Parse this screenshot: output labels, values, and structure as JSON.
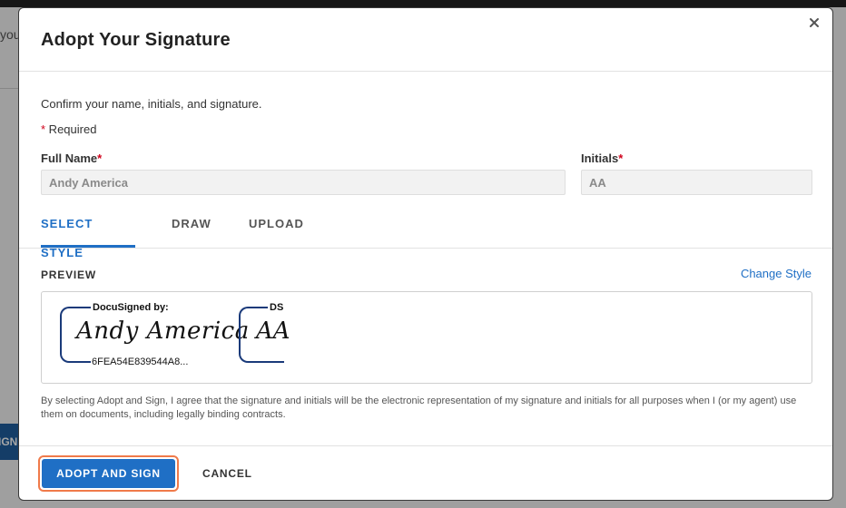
{
  "background": {
    "partial_text": "you",
    "sign_button_fragment": "IGN"
  },
  "modal": {
    "title": "Adopt Your Signature",
    "close_label": "×",
    "intro": "Confirm your name, initials, and signature.",
    "required_star": "*",
    "required_text": " Required",
    "full_name_label": "Full Name",
    "full_name_value": "Andy America",
    "initials_label": "Initials",
    "initials_value": "AA",
    "tabs": [
      {
        "label": "SELECT STYLE",
        "active": true
      },
      {
        "label": "DRAW",
        "active": false
      },
      {
        "label": "UPLOAD",
        "active": false
      }
    ],
    "preview_label": "PREVIEW",
    "change_style_label": "Change Style",
    "signature": {
      "header": "DocuSigned by:",
      "text": "Andy America",
      "id": "6FEA54E839544A8..."
    },
    "initials_preview": {
      "header": "DS",
      "text": "AA"
    },
    "legal_text": "By selecting Adopt and Sign, I agree that the signature and initials will be the electronic representation of my signature and initials for all purposes when I (or my agent) use them on documents, including legally binding contracts.",
    "adopt_button": "ADOPT AND SIGN",
    "cancel_button": "CANCEL"
  },
  "colors": {
    "accent": "#1f6fc5",
    "required": "#d0021b",
    "focus_ring": "#f07a4a",
    "signature_frame": "#1a3a7a"
  }
}
